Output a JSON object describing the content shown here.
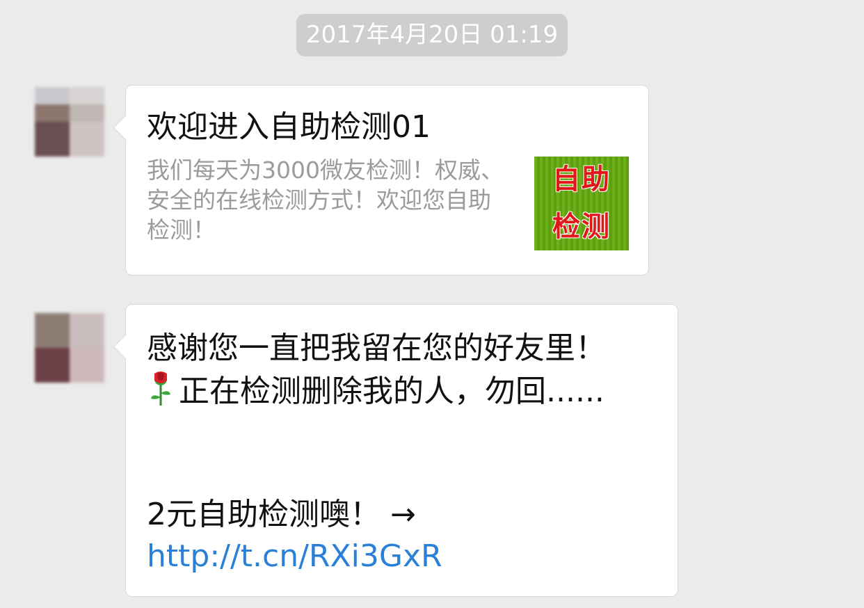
{
  "timestamp": "2017年4月20日 01:19",
  "colors": {
    "background": "#ebebeb",
    "bubble": "#ffffff",
    "link": "#2a7fd6",
    "timestamp_bg": "#cecece"
  },
  "messages": [
    {
      "type": "card",
      "avatar": "avatar-icon",
      "title": "欢迎进入自助检测01",
      "description": "我们每天为3000微友检测！权威、安全的在线检测方式！欢迎您自助检测！",
      "thumbnail": {
        "line1": "自助",
        "line2": "检测"
      }
    },
    {
      "type": "text",
      "avatar": "avatar-icon",
      "line1": "感谢您一直把我留在您的好友里！",
      "line2_icon": "rose-icon",
      "line2": "正在检测删除我的人，勿回......",
      "line3": "2元自助检测噢！",
      "arrow": "→",
      "link": "http://t.cn/RXi3GxR"
    }
  ]
}
